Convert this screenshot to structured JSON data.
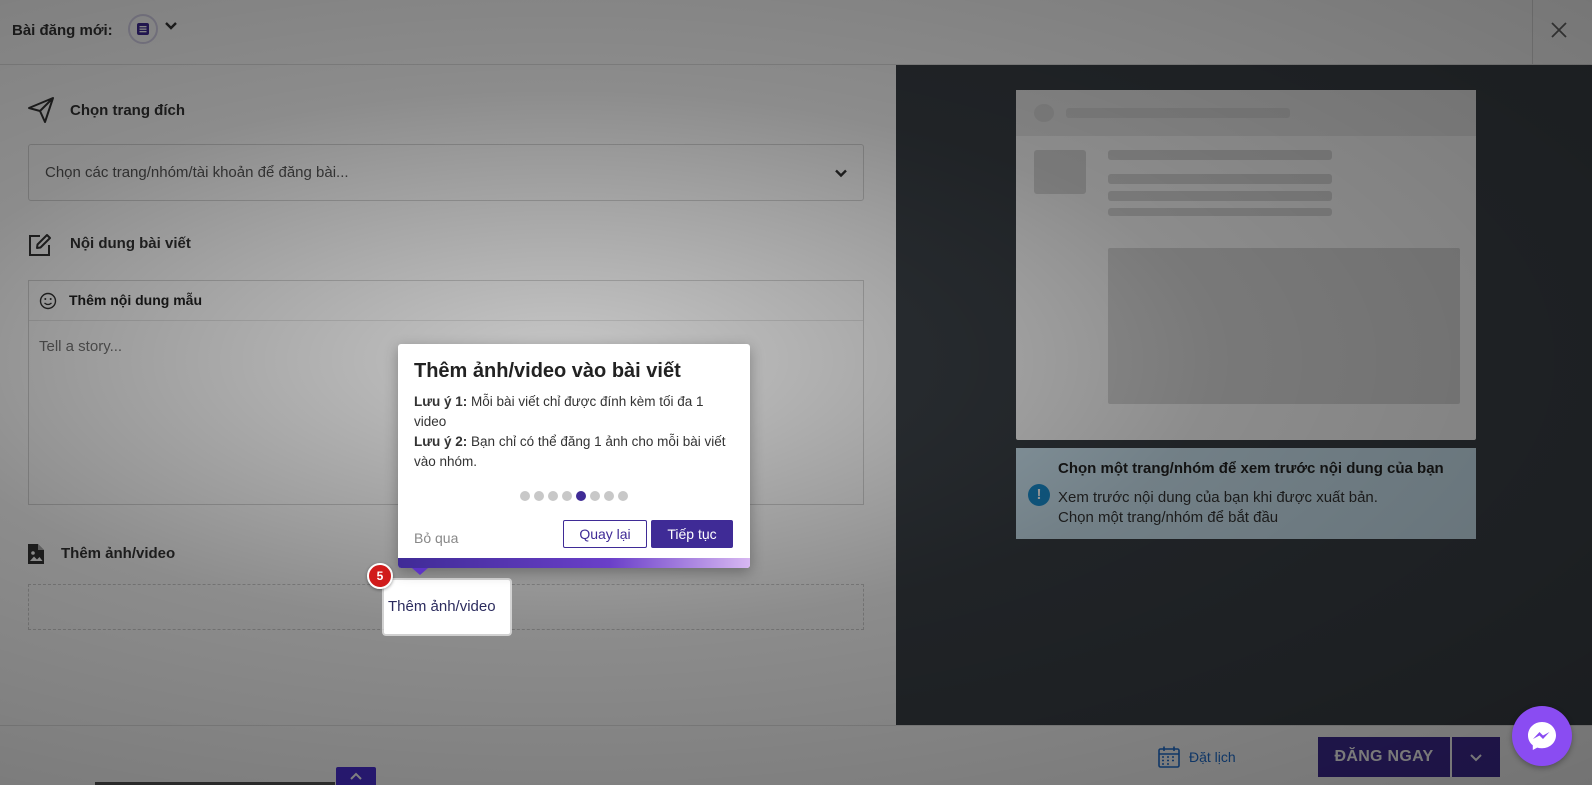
{
  "header": {
    "title": "Bài đăng mới:",
    "account_icon": "account-avatar-icon",
    "close_icon": "close-icon"
  },
  "target_section": {
    "heading": "Chọn trang đích",
    "select_placeholder": "Chọn các trang/nhóm/tài khoản để đăng bài..."
  },
  "content_section": {
    "heading": "Nội dung bài viết",
    "template_label": "Thêm nội dung mẫu",
    "textarea_placeholder": "Tell a story..."
  },
  "media_section": {
    "heading": "Thêm ảnh/video",
    "highlight_label": "Thêm ảnh/video"
  },
  "preview_panel": {
    "info_title": "Chọn một trang/nhóm để xem trước nội dung của bạn",
    "info_line1": "Xem trước nội dung của bạn khi được xuất bản.",
    "info_line2": "Chọn một trang/nhóm để bắt đầu"
  },
  "footer": {
    "schedule_label": "Đặt lịch",
    "post_now_label": "ĐĂNG NGAY"
  },
  "tour": {
    "step_badge": "5",
    "title": "Thêm ảnh/video vào bài viết",
    "note1_label": "Lưu ý 1:",
    "note1_text": " Mỗi bài viết chỉ được đính kèm tối đa 1 video",
    "note2_label": "Lưu ý 2:",
    "note2_text": " Bạn chỉ có thể đăng 1 ảnh cho mỗi bài viết vào nhóm.",
    "total_steps": 8,
    "current_step": 5,
    "skip_label": "Bỏ qua",
    "back_label": "Quay lại",
    "next_label": "Tiếp tục"
  },
  "colors": {
    "primary": "#3f2b96",
    "info_bg": "#cfe8f5",
    "info_icon": "#1a8fd1",
    "badge": "#d11b1b",
    "messenger": "#8a4cf2",
    "dark_panel": "#3a4046"
  }
}
